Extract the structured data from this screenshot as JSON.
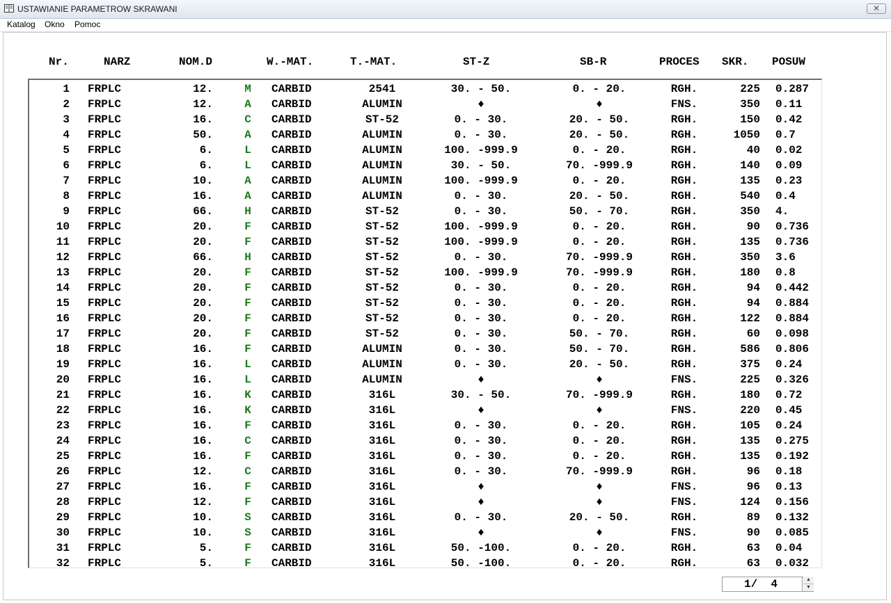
{
  "window": {
    "title": "USTAWIANIE PARAMETROW SKRAWANI",
    "close_symbol": "✕"
  },
  "menu": [
    "Katalog",
    "Okno",
    "Pomoc"
  ],
  "table": {
    "headers": [
      "Nr.",
      "NARZ",
      "NOM.D",
      "W.-MAT.",
      "T.-MAT.",
      "ST-Z",
      "SB-R",
      "PROCES",
      "SKR.",
      "POSUW"
    ],
    "rows": [
      {
        "nr": "1",
        "narz": "FRPLC",
        "nomd": "12.",
        "code": "M",
        "wmat": "CARBID",
        "tmat": "2541",
        "stz": "30. - 50.",
        "sbr": "0. - 20.",
        "proc": "RGH.",
        "skr": "225",
        "posuw": "0.287"
      },
      {
        "nr": "2",
        "narz": "FRPLC",
        "nomd": "12.",
        "code": "A",
        "wmat": "CARBID",
        "tmat": "ALUMIN",
        "stz": "♦",
        "sbr": "♦",
        "proc": "FNS.",
        "skr": "350",
        "posuw": "0.11"
      },
      {
        "nr": "3",
        "narz": "FRPLC",
        "nomd": "16.",
        "code": "C",
        "wmat": "CARBID",
        "tmat": "ST-52",
        "stz": "0. - 30.",
        "sbr": "20. - 50.",
        "proc": "RGH.",
        "skr": "150",
        "posuw": "0.42"
      },
      {
        "nr": "4",
        "narz": "FRPLC",
        "nomd": "50.",
        "code": "A",
        "wmat": "CARBID",
        "tmat": "ALUMIN",
        "stz": "0. - 30.",
        "sbr": "20. - 50.",
        "proc": "RGH.",
        "skr": "1050",
        "posuw": "0.7"
      },
      {
        "nr": "5",
        "narz": "FRPLC",
        "nomd": "6.",
        "code": "L",
        "wmat": "CARBID",
        "tmat": "ALUMIN",
        "stz": "100. -999.9",
        "sbr": "0. - 20.",
        "proc": "RGH.",
        "skr": "40",
        "posuw": "0.02"
      },
      {
        "nr": "6",
        "narz": "FRPLC",
        "nomd": "6.",
        "code": "L",
        "wmat": "CARBID",
        "tmat": "ALUMIN",
        "stz": "30. - 50.",
        "sbr": "70. -999.9",
        "proc": "RGH.",
        "skr": "140",
        "posuw": "0.09"
      },
      {
        "nr": "7",
        "narz": "FRPLC",
        "nomd": "10.",
        "code": "A",
        "wmat": "CARBID",
        "tmat": "ALUMIN",
        "stz": "100. -999.9",
        "sbr": "0. - 20.",
        "proc": "RGH.",
        "skr": "135",
        "posuw": "0.23"
      },
      {
        "nr": "8",
        "narz": "FRPLC",
        "nomd": "16.",
        "code": "A",
        "wmat": "CARBID",
        "tmat": "ALUMIN",
        "stz": "0. - 30.",
        "sbr": "20. - 50.",
        "proc": "RGH.",
        "skr": "540",
        "posuw": "0.4"
      },
      {
        "nr": "9",
        "narz": "FRPLC",
        "nomd": "66.",
        "code": "H",
        "wmat": "CARBID",
        "tmat": "ST-52",
        "stz": "0. - 30.",
        "sbr": "50. - 70.",
        "proc": "RGH.",
        "skr": "350",
        "posuw": "4."
      },
      {
        "nr": "10",
        "narz": "FRPLC",
        "nomd": "20.",
        "code": "F",
        "wmat": "CARBID",
        "tmat": "ST-52",
        "stz": "100. -999.9",
        "sbr": "0. - 20.",
        "proc": "RGH.",
        "skr": "90",
        "posuw": "0.736"
      },
      {
        "nr": "11",
        "narz": "FRPLC",
        "nomd": "20.",
        "code": "F",
        "wmat": "CARBID",
        "tmat": "ST-52",
        "stz": "100. -999.9",
        "sbr": "0. - 20.",
        "proc": "RGH.",
        "skr": "135",
        "posuw": "0.736"
      },
      {
        "nr": "12",
        "narz": "FRPLC",
        "nomd": "66.",
        "code": "H",
        "wmat": "CARBID",
        "tmat": "ST-52",
        "stz": "0. - 30.",
        "sbr": "70. -999.9",
        "proc": "RGH.",
        "skr": "350",
        "posuw": "3.6"
      },
      {
        "nr": "13",
        "narz": "FRPLC",
        "nomd": "20.",
        "code": "F",
        "wmat": "CARBID",
        "tmat": "ST-52",
        "stz": "100. -999.9",
        "sbr": "70. -999.9",
        "proc": "RGH.",
        "skr": "180",
        "posuw": "0.8"
      },
      {
        "nr": "14",
        "narz": "FRPLC",
        "nomd": "20.",
        "code": "F",
        "wmat": "CARBID",
        "tmat": "ST-52",
        "stz": "0. - 30.",
        "sbr": "0. - 20.",
        "proc": "RGH.",
        "skr": "94",
        "posuw": "0.442"
      },
      {
        "nr": "15",
        "narz": "FRPLC",
        "nomd": "20.",
        "code": "F",
        "wmat": "CARBID",
        "tmat": "ST-52",
        "stz": "0. - 30.",
        "sbr": "0. - 20.",
        "proc": "RGH.",
        "skr": "94",
        "posuw": "0.884"
      },
      {
        "nr": "16",
        "narz": "FRPLC",
        "nomd": "20.",
        "code": "F",
        "wmat": "CARBID",
        "tmat": "ST-52",
        "stz": "0. - 30.",
        "sbr": "0. - 20.",
        "proc": "RGH.",
        "skr": "122",
        "posuw": "0.884"
      },
      {
        "nr": "17",
        "narz": "FRPLC",
        "nomd": "20.",
        "code": "F",
        "wmat": "CARBID",
        "tmat": "ST-52",
        "stz": "0. - 30.",
        "sbr": "50. - 70.",
        "proc": "RGH.",
        "skr": "60",
        "posuw": "0.098"
      },
      {
        "nr": "18",
        "narz": "FRPLC",
        "nomd": "16.",
        "code": "F",
        "wmat": "CARBID",
        "tmat": "ALUMIN",
        "stz": "0. - 30.",
        "sbr": "50. - 70.",
        "proc": "RGH.",
        "skr": "586",
        "posuw": "0.806"
      },
      {
        "nr": "19",
        "narz": "FRPLC",
        "nomd": "16.",
        "code": "L",
        "wmat": "CARBID",
        "tmat": "ALUMIN",
        "stz": "0. - 30.",
        "sbr": "20. - 50.",
        "proc": "RGH.",
        "skr": "375",
        "posuw": "0.24"
      },
      {
        "nr": "20",
        "narz": "FRPLC",
        "nomd": "16.",
        "code": "L",
        "wmat": "CARBID",
        "tmat": "ALUMIN",
        "stz": "♦",
        "sbr": "♦",
        "proc": "FNS.",
        "skr": "225",
        "posuw": "0.326"
      },
      {
        "nr": "21",
        "narz": "FRPLC",
        "nomd": "16.",
        "code": "K",
        "wmat": "CARBID",
        "tmat": "316L",
        "stz": "30. - 50.",
        "sbr": "70. -999.9",
        "proc": "RGH.",
        "skr": "180",
        "posuw": "0.72"
      },
      {
        "nr": "22",
        "narz": "FRPLC",
        "nomd": "16.",
        "code": "K",
        "wmat": "CARBID",
        "tmat": "316L",
        "stz": "♦",
        "sbr": "♦",
        "proc": "FNS.",
        "skr": "220",
        "posuw": "0.45"
      },
      {
        "nr": "23",
        "narz": "FRPLC",
        "nomd": "16.",
        "code": "F",
        "wmat": "CARBID",
        "tmat": "316L",
        "stz": "0. - 30.",
        "sbr": "0. - 20.",
        "proc": "RGH.",
        "skr": "105",
        "posuw": "0.24"
      },
      {
        "nr": "24",
        "narz": "FRPLC",
        "nomd": "16.",
        "code": "C",
        "wmat": "CARBID",
        "tmat": "316L",
        "stz": "0. - 30.",
        "sbr": "0. - 20.",
        "proc": "RGH.",
        "skr": "135",
        "posuw": "0.275"
      },
      {
        "nr": "25",
        "narz": "FRPLC",
        "nomd": "16.",
        "code": "F",
        "wmat": "CARBID",
        "tmat": "316L",
        "stz": "0. - 30.",
        "sbr": "0. - 20.",
        "proc": "RGH.",
        "skr": "135",
        "posuw": "0.192"
      },
      {
        "nr": "26",
        "narz": "FRPLC",
        "nomd": "12.",
        "code": "C",
        "wmat": "CARBID",
        "tmat": "316L",
        "stz": "0. - 30.",
        "sbr": "70. -999.9",
        "proc": "RGH.",
        "skr": "96",
        "posuw": "0.18"
      },
      {
        "nr": "27",
        "narz": "FRPLC",
        "nomd": "16.",
        "code": "F",
        "wmat": "CARBID",
        "tmat": "316L",
        "stz": "♦",
        "sbr": "♦",
        "proc": "FNS.",
        "skr": "96",
        "posuw": "0.13"
      },
      {
        "nr": "28",
        "narz": "FRPLC",
        "nomd": "12.",
        "code": "F",
        "wmat": "CARBID",
        "tmat": "316L",
        "stz": "♦",
        "sbr": "♦",
        "proc": "FNS.",
        "skr": "124",
        "posuw": "0.156"
      },
      {
        "nr": "29",
        "narz": "FRPLC",
        "nomd": "10.",
        "code": "S",
        "wmat": "CARBID",
        "tmat": "316L",
        "stz": "0. - 30.",
        "sbr": "20. - 50.",
        "proc": "RGH.",
        "skr": "89",
        "posuw": "0.132"
      },
      {
        "nr": "30",
        "narz": "FRPLC",
        "nomd": "10.",
        "code": "S",
        "wmat": "CARBID",
        "tmat": "316L",
        "stz": "♦",
        "sbr": "♦",
        "proc": "FNS.",
        "skr": "90",
        "posuw": "0.085"
      },
      {
        "nr": "31",
        "narz": "FRPLC",
        "nomd": "5.",
        "code": "F",
        "wmat": "CARBID",
        "tmat": "316L",
        "stz": "50. -100.",
        "sbr": "0. - 20.",
        "proc": "RGH.",
        "skr": "63",
        "posuw": "0.04"
      },
      {
        "nr": "32",
        "narz": "FRPLC",
        "nomd": "5.",
        "code": "F",
        "wmat": "CARBID",
        "tmat": "316L",
        "stz": "50. -100.",
        "sbr": "0. - 20.",
        "proc": "RGH.",
        "skr": "63",
        "posuw": "0.032"
      }
    ]
  },
  "pager": {
    "text": "1/  4",
    "up_symbol": "▲",
    "down_symbol": "▼"
  },
  "colors": {
    "code_letter": "#1b7a1b"
  }
}
